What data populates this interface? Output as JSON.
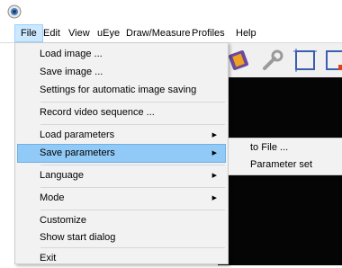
{
  "menubar": {
    "items": [
      "File",
      "Edit",
      "View",
      "uEye",
      "Draw/Measure",
      "Profiles",
      "Help"
    ]
  },
  "file_menu": {
    "items": [
      {
        "label": "Load image ..."
      },
      {
        "label": "Save image ..."
      },
      {
        "label": "Settings for automatic image saving"
      },
      {
        "label": "Record video sequence ..."
      },
      {
        "label": "Load parameters",
        "submenu": true
      },
      {
        "label": "Save parameters",
        "submenu": true,
        "highlighted": true
      },
      {
        "label": "Language",
        "submenu": true
      },
      {
        "label": "Mode",
        "submenu": true
      },
      {
        "label": "Customize"
      },
      {
        "label": "Show start dialog"
      },
      {
        "label": "Exit"
      }
    ],
    "submenu_arrow": "▶"
  },
  "save_parameters_submenu": {
    "items": [
      "to File ...",
      "Parameter set"
    ]
  },
  "colors": {
    "menu_active_bg": "#cce8ff",
    "item_highlight_bg": "#91c9f7",
    "viewport_bg": "#050505"
  },
  "icons": [
    "app-camera-icon",
    "film-icon",
    "wrench-icon",
    "crop-frame-icon"
  ]
}
